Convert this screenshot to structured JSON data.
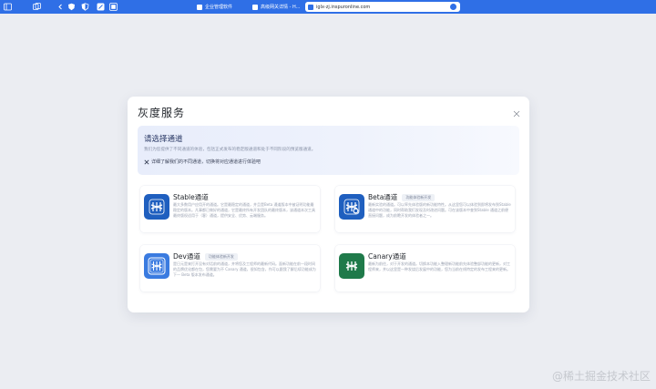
{
  "browser": {
    "tabs": [
      {
        "label": "企业管理软件",
        "active": false
      },
      {
        "label": "高级网关详情 - H...",
        "active": false
      },
      {
        "label": "iglx-zj.inspuronline.com",
        "active": true
      }
    ]
  },
  "dialog": {
    "title": "灰度服务",
    "banner": {
      "title": "请选择通道",
      "description": "我们为您提供了不同通道的体验，包括正式发布的稳定版通道和处于不同阶段的预览版通道。",
      "link": "详细了解我们的不同通道，切换将对应通道进行体验吧"
    },
    "cards": [
      {
        "name": "Stable通道",
        "badge": "",
        "logo_color": "#1f5fbf",
        "description": "最大多数用户应用开的通道。它是最稳定的通道，并且是Beta 通道版本中被证明功能最稳定的版本。凡事都已做好的通道，它是最终所有开发团队的最终版本，该通道本次工具最终版权适用于（客）通道，提供安全、优势、云端服务。"
      },
      {
        "name": "Beta通道",
        "badge": "功能体验新开发",
        "logo_color": "#1f5fbf",
        "description": "最新实验的通道。可以率先体验版的新功能特性。从这里您可以体验到即将发布到Stable通道中的功能，同时帮助我们发现及时改进问题。可在该版本中查到Stable 通道之前便直接问题，成为前瞻开发的体验者之一。"
      },
      {
        "name": "Dev通道",
        "badge": "功能体验新开发",
        "logo_color": "#3a7be0",
        "description": "是日元是来打开没有对话前的通道，并将您及工程师的最新代码。面新功能在前一段时间的品牌优化都在包，您需要为不 Canary 通道，很如包含，作可以跟我了解后续功能成为下一 Beta 版本发布通道。"
      },
      {
        "name": "Canary通道",
        "badge": "",
        "logo_color": "#1f7a4a",
        "description": "最新为前往，对于开发的通道。切换本功能入整理新功能前先体验整部功能的更新，对工程师来，并以这里是一种发烧后发展中的功能，您为当前在线特定的发布工程来的更新。"
      }
    ]
  },
  "watermark": "@稀土掘金技术社区"
}
